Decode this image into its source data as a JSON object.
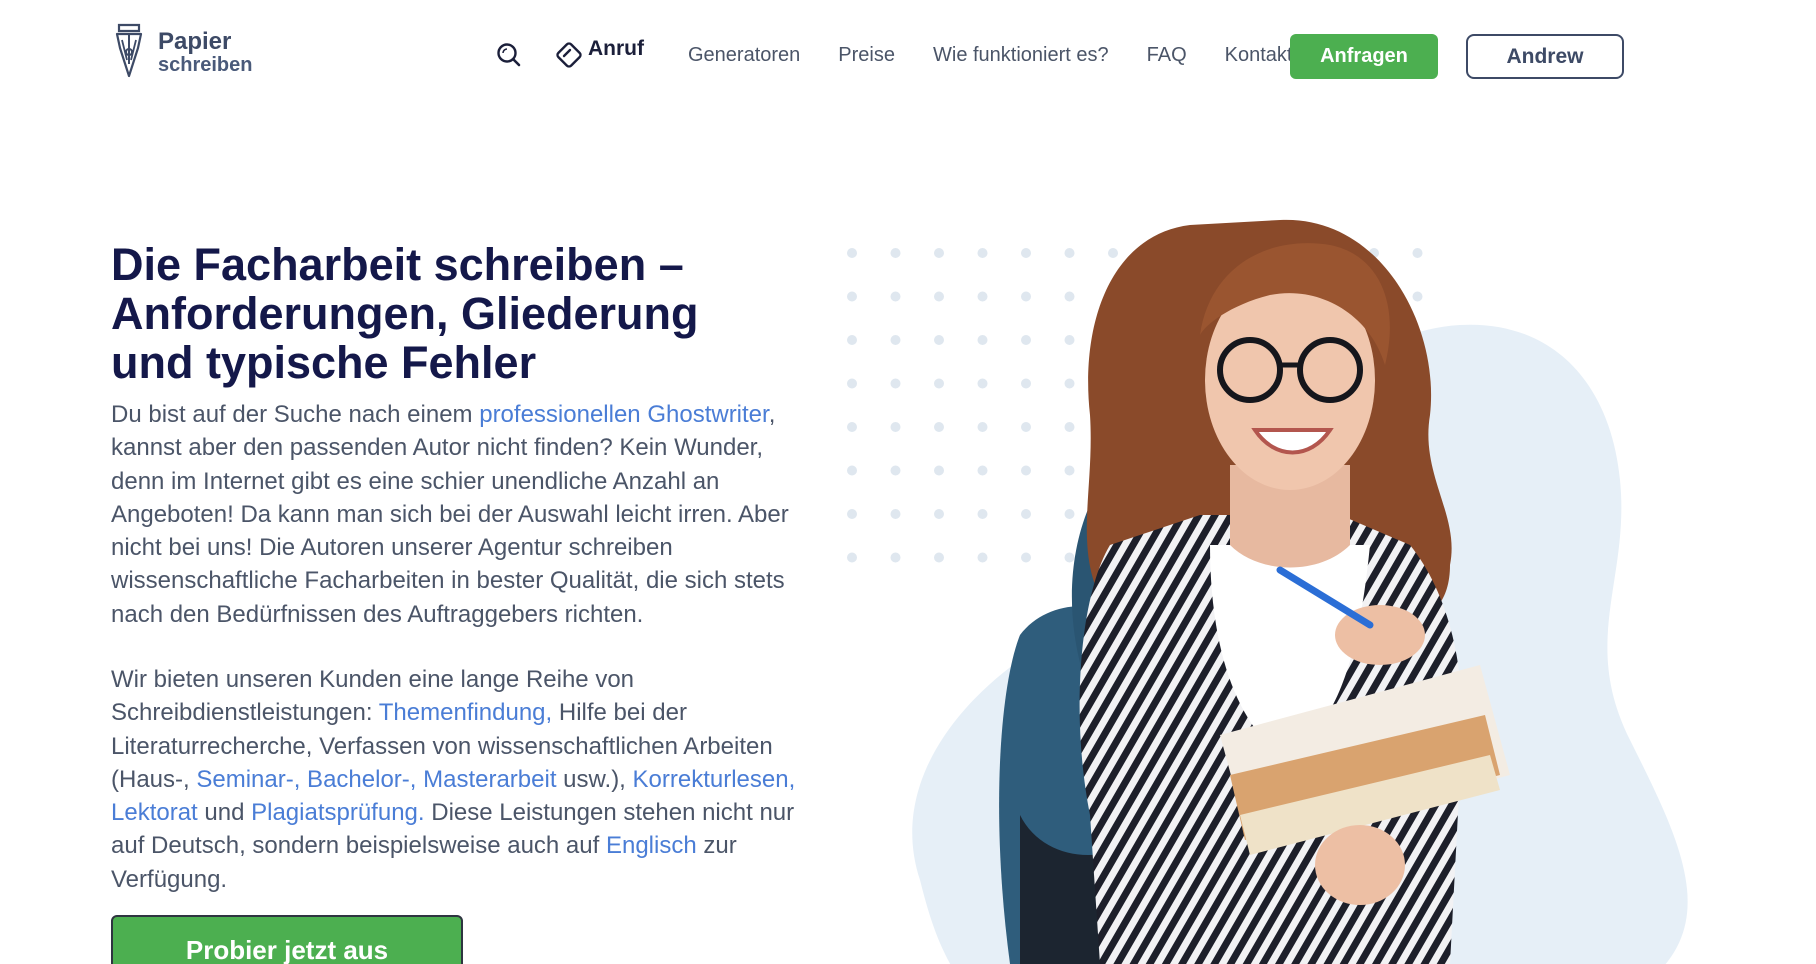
{
  "header": {
    "logo": {
      "line1": "Papier",
      "line2": "schreiben",
      "icon": "fountain-pen-icon"
    },
    "search_icon": "search-icon",
    "call": {
      "icon": "diamond-call-icon",
      "label": "Anruf"
    },
    "nav": [
      {
        "label": "Generatoren"
      },
      {
        "label": "Preise"
      },
      {
        "label": "Wie funktioniert es?"
      },
      {
        "label": "FAQ"
      },
      {
        "label": "Kontakt"
      }
    ],
    "cta_label": "Anfragen",
    "user_label": "Andrew"
  },
  "hero": {
    "title": "Die Facharbeit schreiben – Anforderungen, Gliederung und typische Fehler",
    "para1": {
      "before_link": "Du bist auf der Suche nach einem ",
      "link": "professionellen Ghostwriter",
      "after_link": ", kannst aber den passenden Autor nicht finden? Kein Wunder, denn im Internet gibt es eine schier unendliche Anzahl an Angeboten! Da kann man sich bei der Auswahl leicht irren. Aber nicht bei uns! Die Autoren unserer Agentur schreiben wissenschaftliche Facharbeiten in bester Qualität, die sich stets nach den Bedürfnissen des Auftraggebers richten."
    },
    "para2": {
      "t1": "Wir bieten unseren Kunden eine lange Reihe von Schreibdienstleistungen: ",
      "l1": "Themenfindung,",
      "t2": " Hilfe bei der Literaturrecherche, Verfassen von wissenschaftlichen Arbeiten (Haus-, ",
      "l2": "Seminar-, Bachelor-, Masterarbeit",
      "t3": " usw.), ",
      "l3": "Korrekturlesen, Lektorat",
      "t4": " und ",
      "l4": "Plagiatsprüfung.",
      "t5": " Diese Leistungen stehen nicht nur auf Deutsch, sondern beispielsweise auch auf ",
      "l5": "Englisch",
      "t6": " zur Verfügung."
    },
    "cta_label": "Probier jetzt aus"
  },
  "colors": {
    "green": "#4caf50",
    "navy": "#14184a",
    "link": "#4a7dd6",
    "blob": "#e6eff7"
  }
}
